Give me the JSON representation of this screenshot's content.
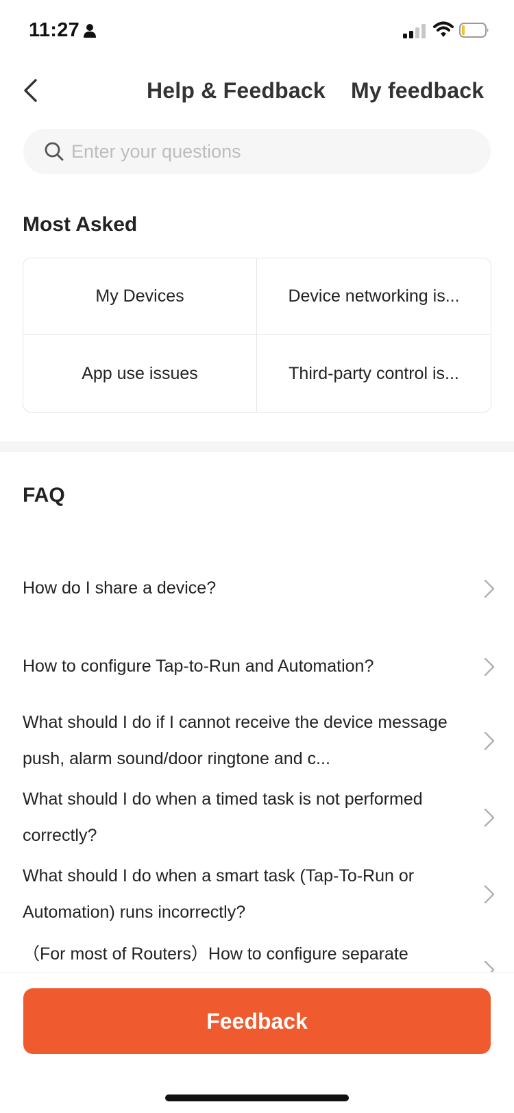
{
  "status_bar": {
    "time": "11:27",
    "icons": [
      "person-icon",
      "signal-icon",
      "wifi-icon",
      "battery-icon"
    ]
  },
  "nav": {
    "title": "Help & Feedback",
    "my_feedback_label": "My feedback",
    "back_icon": "chevron-left-icon"
  },
  "search": {
    "placeholder": "Enter your questions",
    "value": "",
    "icon": "search-icon"
  },
  "most_asked": {
    "title": "Most Asked",
    "items": [
      {
        "label": "My Devices"
      },
      {
        "label": "Device networking is..."
      },
      {
        "label": "App use issues"
      },
      {
        "label": "Third-party control is..."
      }
    ]
  },
  "faq": {
    "title": "FAQ",
    "items": [
      {
        "text": "How do I share a device?"
      },
      {
        "text": "How to configure Tap-to-Run and Automation?"
      },
      {
        "text": "What should I do if I cannot receive the device message push, alarm sound/door ringtone and c..."
      },
      {
        "text": "What should I do when a timed task is not performed correctly?"
      },
      {
        "text": "What should I do when a smart task (Tap-To-Run or Automation) runs incorrectly?"
      },
      {
        "text": "（For most of Routers）How to configure separate"
      }
    ]
  },
  "feedback_button": {
    "label": "Feedback"
  },
  "colors": {
    "accent": "#f05a2f",
    "text_primary": "#222222",
    "placeholder": "#bdbdbd",
    "search_bg": "#f6f6f6",
    "divider": "#e6e6e6"
  }
}
